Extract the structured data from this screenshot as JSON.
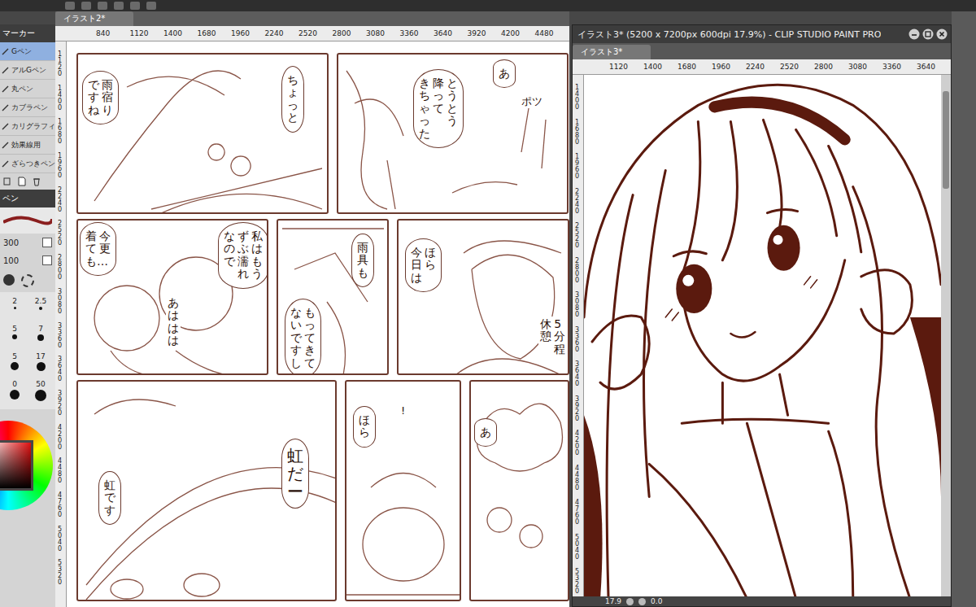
{
  "tool_panel": {
    "header": "マーカー",
    "brushes": [
      {
        "label": "Gペン",
        "selected": true
      },
      {
        "label": "アルGペン",
        "selected": false
      },
      {
        "label": "丸ペン",
        "selected": false
      },
      {
        "label": "カブラペン",
        "selected": false
      },
      {
        "label": "カリグラフィ",
        "selected": false
      },
      {
        "label": "効果線用",
        "selected": false
      },
      {
        "label": "ざらつきペン",
        "selected": false
      }
    ],
    "property_header": "ペン",
    "property_values": [
      "300",
      "100"
    ],
    "sizes": [
      "2",
      "2.5",
      "5",
      "7",
      "5",
      "17",
      "0",
      "50"
    ]
  },
  "left_document": {
    "tab": "イラスト2*",
    "ruler_x": [
      "840",
      "1120",
      "1400",
      "1680",
      "1960",
      "2240",
      "2520",
      "2800",
      "3080",
      "3360",
      "3640",
      "3920",
      "4200",
      "4480"
    ],
    "ruler_y": [
      "1120",
      "1400",
      "1680",
      "1960",
      "2240",
      "2520",
      "2800",
      "3080",
      "3360",
      "3640",
      "3920",
      "4200",
      "4480",
      "4760",
      "5040",
      "5320"
    ],
    "rows": [
      {
        "panels": [
          {
            "texts": [
              {
                "kind": "bubble",
                "lines": [
                  "雨宿り",
                  "ですね"
                ]
              },
              {
                "kind": "bubble",
                "lines": [
                  "ちょっと"
                ]
              }
            ]
          },
          {
            "texts": [
              {
                "kind": "bubble",
                "lines": [
                  "あ"
                ]
              },
              {
                "kind": "bubble",
                "lines": [
                  "とうとう",
                  "降って",
                  "きちゃった"
                ]
              },
              {
                "kind": "mark",
                "lines": [
                  "ポツ"
                ]
              }
            ]
          }
        ]
      },
      {
        "panels": [
          {
            "texts": [
              {
                "kind": "bubble",
                "lines": [
                  "今更",
                  "着ても…"
                ]
              },
              {
                "kind": "bubble",
                "lines": [
                  "私はもう",
                  "ずぶ濡れ",
                  "なので"
                ]
              },
              {
                "kind": "sfx",
                "lines": [
                  "あははは"
                ]
              }
            ]
          },
          {
            "texts": [
              {
                "kind": "bubble",
                "lines": [
                  "雨具も"
                ]
              },
              {
                "kind": "bubble",
                "lines": [
                  "もってきて",
                  "ないですし"
                ]
              }
            ]
          },
          {
            "texts": [
              {
                "kind": "bubble",
                "lines": [
                  "ほら",
                  "今日は"
                ]
              },
              {
                "kind": "sfx",
                "lines": [
                  "5分程",
                  "休憩"
                ]
              }
            ]
          }
        ]
      },
      {
        "panels": [
          {
            "texts": [
              {
                "kind": "bubble",
                "lines": [
                  "虹です"
                ]
              },
              {
                "kind": "bubble",
                "lines": [
                  "虹だー"
                ]
              }
            ]
          },
          {
            "texts": [
              {
                "kind": "bubble",
                "lines": [
                  "ほら"
                ]
              },
              {
                "kind": "mark",
                "lines": [
                  "!"
                ]
              }
            ]
          },
          {
            "texts": [
              {
                "kind": "bubble",
                "lines": [
                  "あ"
                ]
              }
            ]
          }
        ]
      }
    ]
  },
  "right_window": {
    "title": "イラスト3* (5200 x 7200px 600dpi 17.9%) - CLIP STUDIO PAINT PRO",
    "tab": "イラスト3*",
    "ruler_x": [
      "1120",
      "1400",
      "1680",
      "1960",
      "2240",
      "2520",
      "2800",
      "3080",
      "3360",
      "3640"
    ],
    "ruler_y": [
      "1400",
      "1680",
      "1960",
      "2240",
      "2520",
      "2800",
      "3080",
      "3360",
      "3640",
      "3920",
      "4200",
      "4480",
      "4760",
      "5040",
      "5320"
    ],
    "zoom": "17.9",
    "angle": "0.0"
  }
}
